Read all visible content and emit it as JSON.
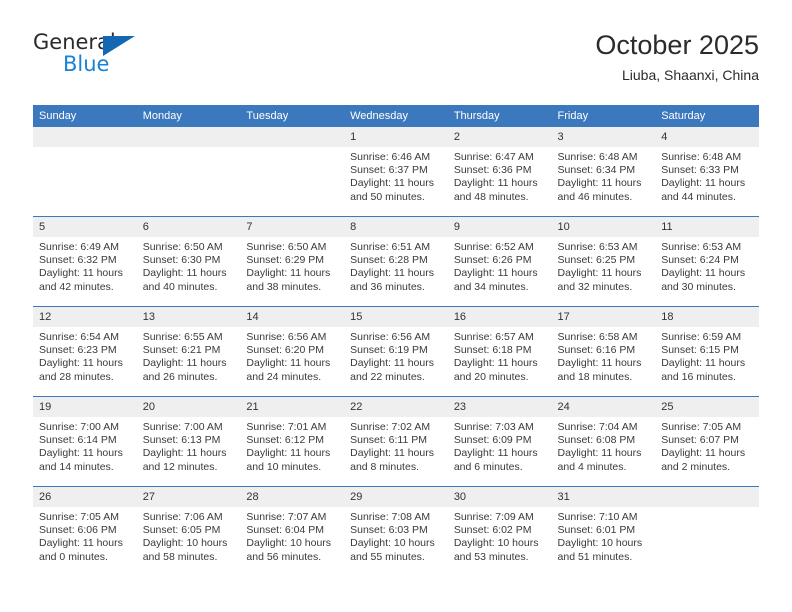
{
  "brand": {
    "name_top": "General",
    "name_bottom": "Blue",
    "triangle_icon": "blue-triangle-logo"
  },
  "header": {
    "title": "October 2025",
    "subtitle": "Liuba, Shaanxi, China"
  },
  "colors": {
    "header_blue": "#3c78be",
    "daynum_band": "#efefef",
    "brand_blue": "#1b81d4",
    "logo_blue": "#1567b3",
    "text": "#2b2b2b"
  },
  "weekday_headers": [
    "Sunday",
    "Monday",
    "Tuesday",
    "Wednesday",
    "Thursday",
    "Friday",
    "Saturday"
  ],
  "weeks": [
    [
      {
        "day": "",
        "sunrise": "",
        "sunset": "",
        "daylight1": "",
        "daylight2": ""
      },
      {
        "day": "",
        "sunrise": "",
        "sunset": "",
        "daylight1": "",
        "daylight2": ""
      },
      {
        "day": "",
        "sunrise": "",
        "sunset": "",
        "daylight1": "",
        "daylight2": ""
      },
      {
        "day": "1",
        "sunrise": "Sunrise: 6:46 AM",
        "sunset": "Sunset: 6:37 PM",
        "daylight1": "Daylight: 11 hours",
        "daylight2": "and 50 minutes."
      },
      {
        "day": "2",
        "sunrise": "Sunrise: 6:47 AM",
        "sunset": "Sunset: 6:36 PM",
        "daylight1": "Daylight: 11 hours",
        "daylight2": "and 48 minutes."
      },
      {
        "day": "3",
        "sunrise": "Sunrise: 6:48 AM",
        "sunset": "Sunset: 6:34 PM",
        "daylight1": "Daylight: 11 hours",
        "daylight2": "and 46 minutes."
      },
      {
        "day": "4",
        "sunrise": "Sunrise: 6:48 AM",
        "sunset": "Sunset: 6:33 PM",
        "daylight1": "Daylight: 11 hours",
        "daylight2": "and 44 minutes."
      }
    ],
    [
      {
        "day": "5",
        "sunrise": "Sunrise: 6:49 AM",
        "sunset": "Sunset: 6:32 PM",
        "daylight1": "Daylight: 11 hours",
        "daylight2": "and 42 minutes."
      },
      {
        "day": "6",
        "sunrise": "Sunrise: 6:50 AM",
        "sunset": "Sunset: 6:30 PM",
        "daylight1": "Daylight: 11 hours",
        "daylight2": "and 40 minutes."
      },
      {
        "day": "7",
        "sunrise": "Sunrise: 6:50 AM",
        "sunset": "Sunset: 6:29 PM",
        "daylight1": "Daylight: 11 hours",
        "daylight2": "and 38 minutes."
      },
      {
        "day": "8",
        "sunrise": "Sunrise: 6:51 AM",
        "sunset": "Sunset: 6:28 PM",
        "daylight1": "Daylight: 11 hours",
        "daylight2": "and 36 minutes."
      },
      {
        "day": "9",
        "sunrise": "Sunrise: 6:52 AM",
        "sunset": "Sunset: 6:26 PM",
        "daylight1": "Daylight: 11 hours",
        "daylight2": "and 34 minutes."
      },
      {
        "day": "10",
        "sunrise": "Sunrise: 6:53 AM",
        "sunset": "Sunset: 6:25 PM",
        "daylight1": "Daylight: 11 hours",
        "daylight2": "and 32 minutes."
      },
      {
        "day": "11",
        "sunrise": "Sunrise: 6:53 AM",
        "sunset": "Sunset: 6:24 PM",
        "daylight1": "Daylight: 11 hours",
        "daylight2": "and 30 minutes."
      }
    ],
    [
      {
        "day": "12",
        "sunrise": "Sunrise: 6:54 AM",
        "sunset": "Sunset: 6:23 PM",
        "daylight1": "Daylight: 11 hours",
        "daylight2": "and 28 minutes."
      },
      {
        "day": "13",
        "sunrise": "Sunrise: 6:55 AM",
        "sunset": "Sunset: 6:21 PM",
        "daylight1": "Daylight: 11 hours",
        "daylight2": "and 26 minutes."
      },
      {
        "day": "14",
        "sunrise": "Sunrise: 6:56 AM",
        "sunset": "Sunset: 6:20 PM",
        "daylight1": "Daylight: 11 hours",
        "daylight2": "and 24 minutes."
      },
      {
        "day": "15",
        "sunrise": "Sunrise: 6:56 AM",
        "sunset": "Sunset: 6:19 PM",
        "daylight1": "Daylight: 11 hours",
        "daylight2": "and 22 minutes."
      },
      {
        "day": "16",
        "sunrise": "Sunrise: 6:57 AM",
        "sunset": "Sunset: 6:18 PM",
        "daylight1": "Daylight: 11 hours",
        "daylight2": "and 20 minutes."
      },
      {
        "day": "17",
        "sunrise": "Sunrise: 6:58 AM",
        "sunset": "Sunset: 6:16 PM",
        "daylight1": "Daylight: 11 hours",
        "daylight2": "and 18 minutes."
      },
      {
        "day": "18",
        "sunrise": "Sunrise: 6:59 AM",
        "sunset": "Sunset: 6:15 PM",
        "daylight1": "Daylight: 11 hours",
        "daylight2": "and 16 minutes."
      }
    ],
    [
      {
        "day": "19",
        "sunrise": "Sunrise: 7:00 AM",
        "sunset": "Sunset: 6:14 PM",
        "daylight1": "Daylight: 11 hours",
        "daylight2": "and 14 minutes."
      },
      {
        "day": "20",
        "sunrise": "Sunrise: 7:00 AM",
        "sunset": "Sunset: 6:13 PM",
        "daylight1": "Daylight: 11 hours",
        "daylight2": "and 12 minutes."
      },
      {
        "day": "21",
        "sunrise": "Sunrise: 7:01 AM",
        "sunset": "Sunset: 6:12 PM",
        "daylight1": "Daylight: 11 hours",
        "daylight2": "and 10 minutes."
      },
      {
        "day": "22",
        "sunrise": "Sunrise: 7:02 AM",
        "sunset": "Sunset: 6:11 PM",
        "daylight1": "Daylight: 11 hours",
        "daylight2": "and 8 minutes."
      },
      {
        "day": "23",
        "sunrise": "Sunrise: 7:03 AM",
        "sunset": "Sunset: 6:09 PM",
        "daylight1": "Daylight: 11 hours",
        "daylight2": "and 6 minutes."
      },
      {
        "day": "24",
        "sunrise": "Sunrise: 7:04 AM",
        "sunset": "Sunset: 6:08 PM",
        "daylight1": "Daylight: 11 hours",
        "daylight2": "and 4 minutes."
      },
      {
        "day": "25",
        "sunrise": "Sunrise: 7:05 AM",
        "sunset": "Sunset: 6:07 PM",
        "daylight1": "Daylight: 11 hours",
        "daylight2": "and 2 minutes."
      }
    ],
    [
      {
        "day": "26",
        "sunrise": "Sunrise: 7:05 AM",
        "sunset": "Sunset: 6:06 PM",
        "daylight1": "Daylight: 11 hours",
        "daylight2": "and 0 minutes."
      },
      {
        "day": "27",
        "sunrise": "Sunrise: 7:06 AM",
        "sunset": "Sunset: 6:05 PM",
        "daylight1": "Daylight: 10 hours",
        "daylight2": "and 58 minutes."
      },
      {
        "day": "28",
        "sunrise": "Sunrise: 7:07 AM",
        "sunset": "Sunset: 6:04 PM",
        "daylight1": "Daylight: 10 hours",
        "daylight2": "and 56 minutes."
      },
      {
        "day": "29",
        "sunrise": "Sunrise: 7:08 AM",
        "sunset": "Sunset: 6:03 PM",
        "daylight1": "Daylight: 10 hours",
        "daylight2": "and 55 minutes."
      },
      {
        "day": "30",
        "sunrise": "Sunrise: 7:09 AM",
        "sunset": "Sunset: 6:02 PM",
        "daylight1": "Daylight: 10 hours",
        "daylight2": "and 53 minutes."
      },
      {
        "day": "31",
        "sunrise": "Sunrise: 7:10 AM",
        "sunset": "Sunset: 6:01 PM",
        "daylight1": "Daylight: 10 hours",
        "daylight2": "and 51 minutes."
      },
      {
        "day": "",
        "sunrise": "",
        "sunset": "",
        "daylight1": "",
        "daylight2": ""
      }
    ]
  ]
}
